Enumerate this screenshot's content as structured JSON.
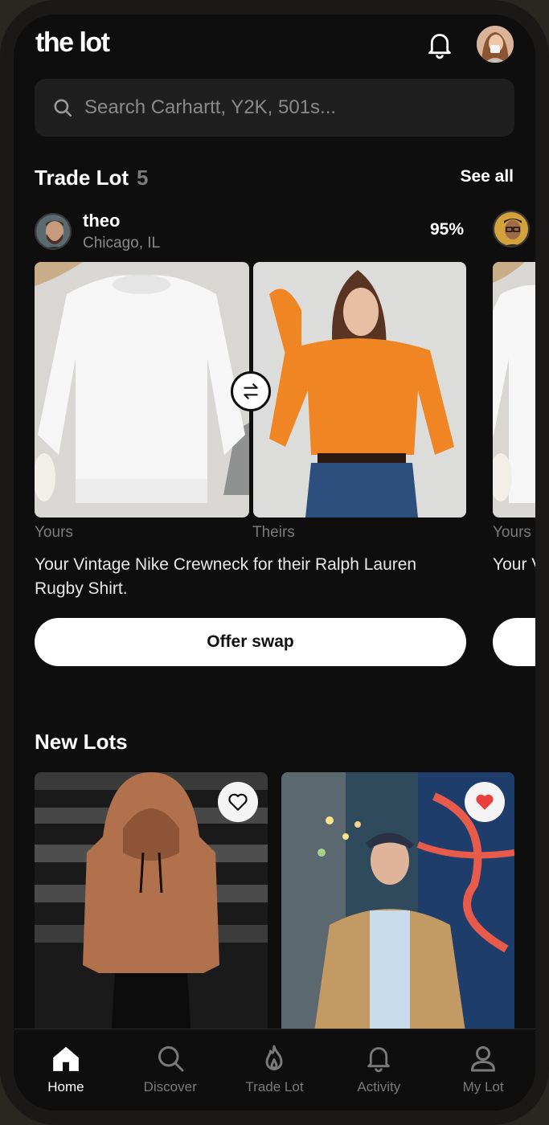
{
  "app": {
    "logo": "the lot"
  },
  "search": {
    "placeholder": "Search Carhartt, Y2K, 501s..."
  },
  "trade_lot": {
    "title": "Trade Lot",
    "count": "5",
    "see_all": "See all",
    "card": {
      "user_name": "theo",
      "user_location": "Chicago, IL",
      "match": "95%",
      "yours_label": "Yours",
      "theirs_label": "Theirs",
      "description": "Your Vintage Nike Crewneck for their Ralph Lauren Rugby Shirt.",
      "button_label": "Offer swap"
    },
    "next_card": {
      "yours_label": "Yours",
      "description_fragment": "Your V Hood"
    }
  },
  "new_lots": {
    "title": "New Lots",
    "items": [
      {
        "favorited": false
      },
      {
        "favorited": true
      }
    ]
  },
  "nav": {
    "tabs": [
      {
        "label": "Home",
        "icon": "home-icon",
        "active": true
      },
      {
        "label": "Discover",
        "icon": "search-icon",
        "active": false
      },
      {
        "label": "Trade Lot",
        "icon": "flame-icon",
        "active": false
      },
      {
        "label": "Activity",
        "icon": "bell-icon",
        "active": false
      },
      {
        "label": "My Lot",
        "icon": "person-icon",
        "active": false
      }
    ]
  },
  "colors": {
    "background": "#0e0e0e",
    "surface": "#1f1f1f",
    "favorite": "#e8403f"
  }
}
